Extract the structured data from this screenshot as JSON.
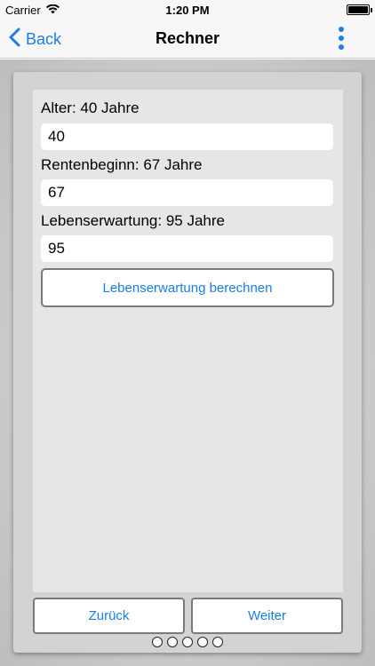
{
  "status_bar": {
    "carrier": "Carrier",
    "time": "1:20 PM"
  },
  "nav": {
    "back_label": "Back",
    "title": "Rechner",
    "accent_color": "#1a7ee6"
  },
  "form": {
    "age_label": "Alter: 40 Jahre",
    "age_value": "40",
    "retirement_label": "Rentenbeginn: 67 Jahre",
    "retirement_value": "67",
    "life_expectancy_label": "Lebenserwartung: 95 Jahre",
    "life_expectancy_value": "95",
    "calculate_button": "Lebenserwartung berechnen"
  },
  "footer": {
    "back_button": "Zurück",
    "next_button": "Weiter"
  },
  "pager": {
    "page_count": 5
  }
}
